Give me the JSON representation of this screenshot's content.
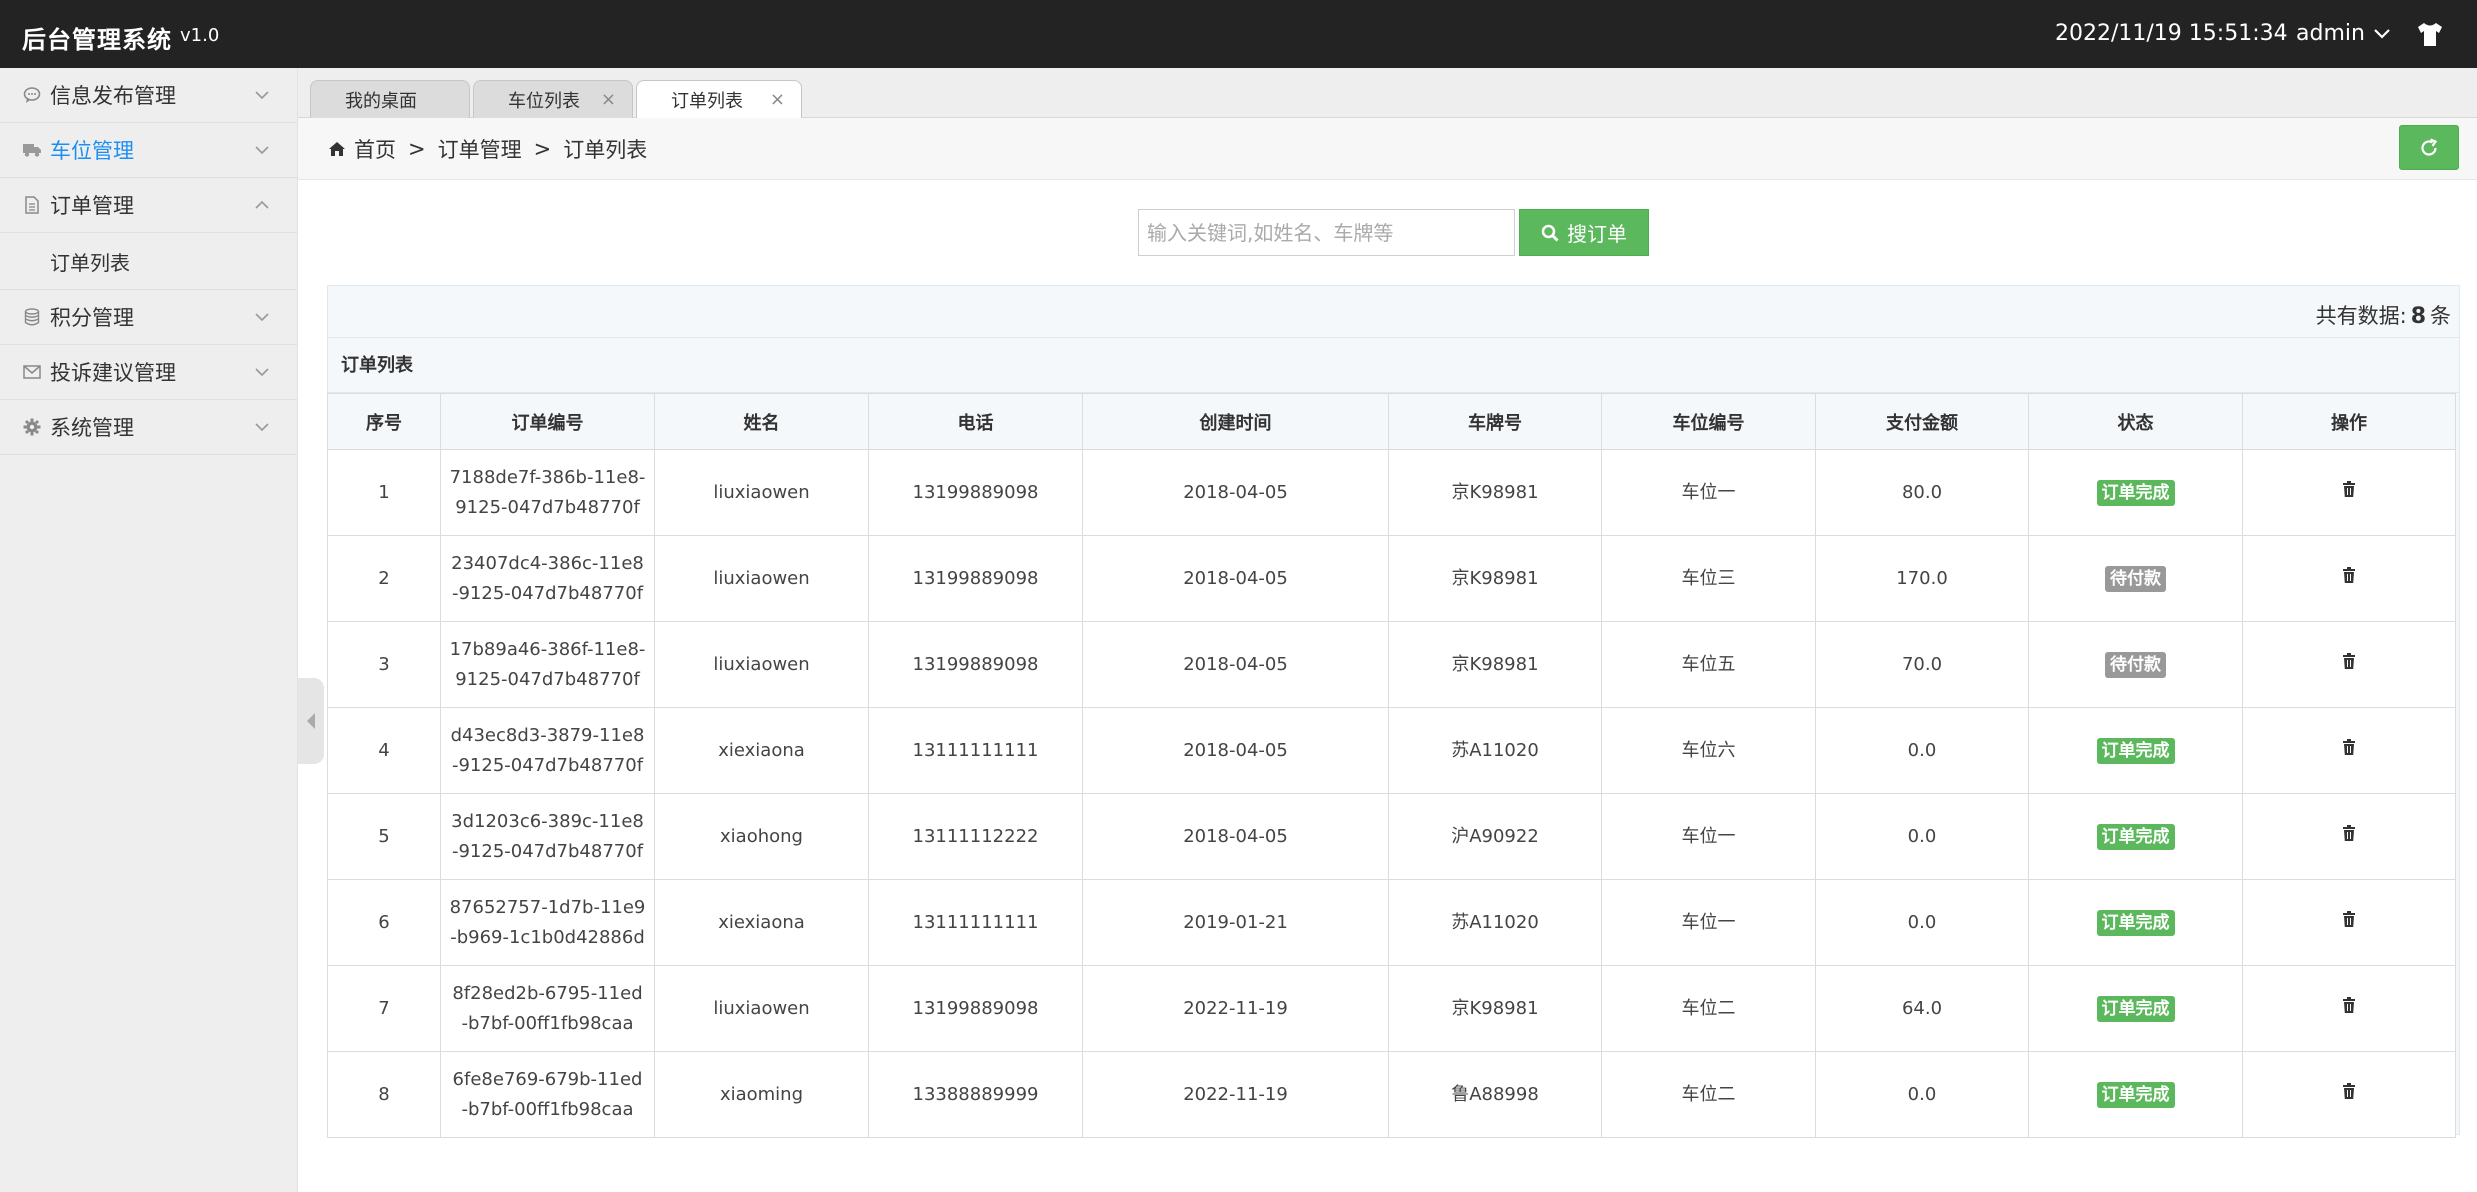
{
  "app": {
    "title": "后台管理系统",
    "version": "v1.0"
  },
  "header": {
    "datetime": "2022/11/19 15:51:34",
    "user": "admin"
  },
  "sidebar": {
    "items": [
      {
        "label": "信息发布管理",
        "expanded": false
      },
      {
        "label": "车位管理",
        "expanded": false,
        "active": true
      },
      {
        "label": "订单管理",
        "expanded": true,
        "children": [
          {
            "label": "订单列表"
          }
        ]
      },
      {
        "label": "积分管理",
        "expanded": false
      },
      {
        "label": "投诉建议管理",
        "expanded": false
      },
      {
        "label": "系统管理",
        "expanded": false
      }
    ]
  },
  "tabs": [
    {
      "label": "我的桌面",
      "closable": false
    },
    {
      "label": "车位列表",
      "closable": true
    },
    {
      "label": "订单列表",
      "closable": true,
      "active": true
    }
  ],
  "breadcrumb": {
    "home": "首页",
    "sep": ">",
    "level1": "订单管理",
    "level2": "订单列表"
  },
  "search": {
    "placeholder": "输入关键词,如姓名、车牌等",
    "value": "",
    "button_label": "搜订单"
  },
  "summary": {
    "prefix": "共有数据:",
    "count": "8",
    "suffix": "条"
  },
  "panel_title": "订单列表",
  "table": {
    "columns": [
      "序号",
      "订单编号",
      "姓名",
      "电话",
      "创建时间",
      "车牌号",
      "车位编号",
      "支付金额",
      "状态",
      "操作"
    ],
    "rows": [
      {
        "no": "1",
        "id1": "7188de7f-386b-11e8-",
        "id2": "9125-047d7b48770f",
        "name": "liuxiaowen",
        "phone": "13199889098",
        "created": "2018-04-05",
        "plate": "京K98981",
        "space": "车位一",
        "amount": "80.0",
        "status": "订单完成",
        "status_type": "done"
      },
      {
        "no": "2",
        "id1": "23407dc4-386c-11e8",
        "id2": "-9125-047d7b48770f",
        "name": "liuxiaowen",
        "phone": "13199889098",
        "created": "2018-04-05",
        "plate": "京K98981",
        "space": "车位三",
        "amount": "170.0",
        "status": "待付款",
        "status_type": "pending"
      },
      {
        "no": "3",
        "id1": "17b89a46-386f-11e8-",
        "id2": "9125-047d7b48770f",
        "name": "liuxiaowen",
        "phone": "13199889098",
        "created": "2018-04-05",
        "plate": "京K98981",
        "space": "车位五",
        "amount": "70.0",
        "status": "待付款",
        "status_type": "pending"
      },
      {
        "no": "4",
        "id1": "d43ec8d3-3879-11e8",
        "id2": "-9125-047d7b48770f",
        "name": "xiexiaona",
        "phone": "13111111111",
        "created": "2018-04-05",
        "plate": "苏A11020",
        "space": "车位六",
        "amount": "0.0",
        "status": "订单完成",
        "status_type": "done"
      },
      {
        "no": "5",
        "id1": "3d1203c6-389c-11e8",
        "id2": "-9125-047d7b48770f",
        "name": "xiaohong",
        "phone": "13111112222",
        "created": "2018-04-05",
        "plate": "沪A90922",
        "space": "车位一",
        "amount": "0.0",
        "status": "订单完成",
        "status_type": "done"
      },
      {
        "no": "6",
        "id1": "87652757-1d7b-11e9",
        "id2": "-b969-1c1b0d42886d",
        "name": "xiexiaona",
        "phone": "13111111111",
        "created": "2019-01-21",
        "plate": "苏A11020",
        "space": "车位一",
        "amount": "0.0",
        "status": "订单完成",
        "status_type": "done"
      },
      {
        "no": "7",
        "id1": "8f28ed2b-6795-11ed",
        "id2": "-b7bf-00ff1fb98caa",
        "name": "liuxiaowen",
        "phone": "13199889098",
        "created": "2022-11-19",
        "plate": "京K98981",
        "space": "车位二",
        "amount": "64.0",
        "status": "订单完成",
        "status_type": "done"
      },
      {
        "no": "8",
        "id1": "6fe8e769-679b-11ed",
        "id2": "-b7bf-00ff1fb98caa",
        "name": "xiaoming",
        "phone": "13388889999",
        "created": "2022-11-19",
        "plate": "鲁A88998",
        "space": "车位二",
        "amount": "0.0",
        "status": "订单完成",
        "status_type": "done"
      }
    ]
  },
  "colors": {
    "topbar": "#232323",
    "accent_blue": "#1e8ff2",
    "success_green": "#5cb85c",
    "pending_gray": "#999999"
  },
  "icons": {
    "menu": [
      "comment-icon",
      "truck-icon",
      "file-icon",
      "database-icon",
      "envelope-icon",
      "gear-icon"
    ],
    "refresh": "refresh-icon",
    "search": "search-icon",
    "delete": "trash-icon",
    "home": "home-icon",
    "user_menu": "tshirt-icon"
  }
}
